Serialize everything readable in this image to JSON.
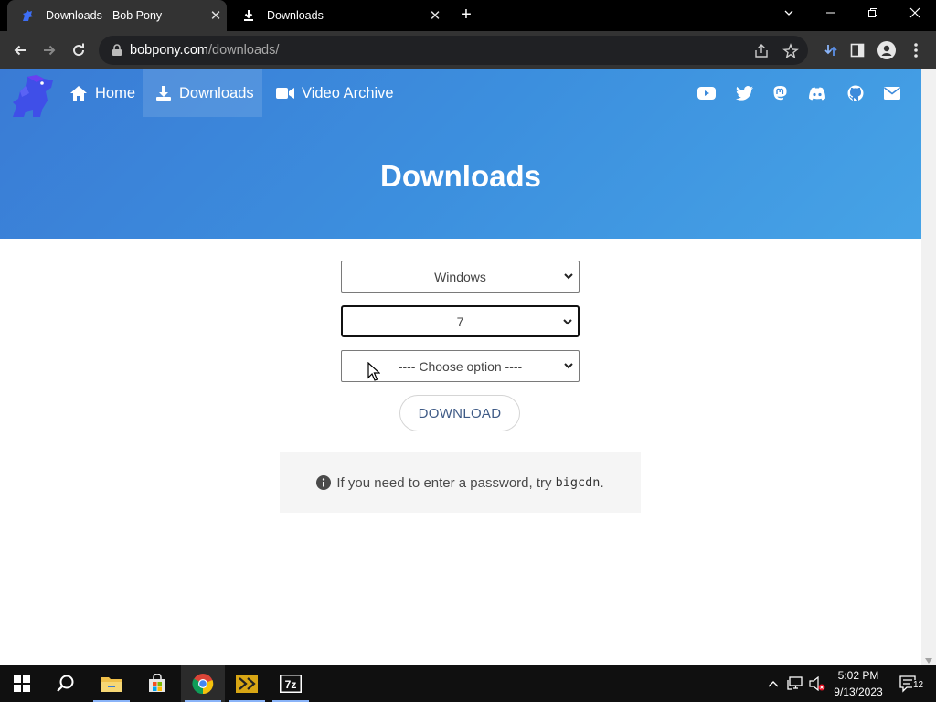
{
  "browser": {
    "tabs": [
      {
        "title": "Downloads - Bob Pony",
        "active": true
      },
      {
        "title": "Downloads",
        "active": false
      }
    ],
    "url_domain": "bobpony.com",
    "url_path": "/downloads/"
  },
  "nav": {
    "items": [
      {
        "label": "Home",
        "icon": "home-icon"
      },
      {
        "label": "Downloads",
        "icon": "download-icon",
        "active": true
      },
      {
        "label": "Video Archive",
        "icon": "video-camera-icon"
      }
    ],
    "social_icons": [
      "youtube-icon",
      "twitter-icon",
      "mastodon-icon",
      "discord-icon",
      "github-icon",
      "mail-icon"
    ]
  },
  "hero": {
    "title": "Downloads"
  },
  "form": {
    "os_select": "Windows",
    "version_select": "7",
    "option_select": "---- Choose option ----",
    "download_label": "DOWNLOAD"
  },
  "notice": {
    "text_before": "If you need to enter a password, try ",
    "code": "bigcdn",
    "text_after": "."
  },
  "taskbar": {
    "time": "5:02 PM",
    "date": "9/13/2023",
    "notification_count": "12"
  },
  "colors": {
    "hero_gradient_start": "#3a7bd5",
    "hero_gradient_end": "#46a3e6",
    "download_text": "#3e5a86"
  }
}
